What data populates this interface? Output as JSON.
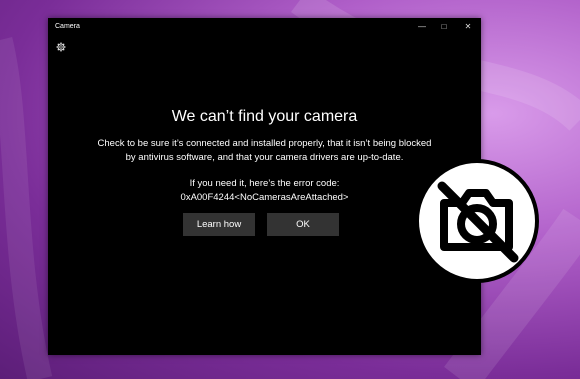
{
  "window": {
    "title": "Camera",
    "minimize_icon": "minimize-icon",
    "maximize_icon": "maximize-icon",
    "close_icon": "close-icon"
  },
  "settings_icon": "gear-icon",
  "message": {
    "heading": "We can’t find your camera",
    "line1": "Check to be sure it’s connected and installed properly, that it isn’t being blocked",
    "line2": "by antivirus software, and that your camera drivers are up-to-date.",
    "error_intro": "If you need it, here’s the error code:",
    "error_code": "0xA00F4244<NoCamerasAreAttached>"
  },
  "buttons": {
    "learn_how": "Learn how",
    "ok": "OK"
  },
  "badge_icon": "camera-off-icon",
  "colors": {
    "window_bg": "#000000",
    "button_bg": "#333333",
    "background_accent": "#b05fc9"
  }
}
